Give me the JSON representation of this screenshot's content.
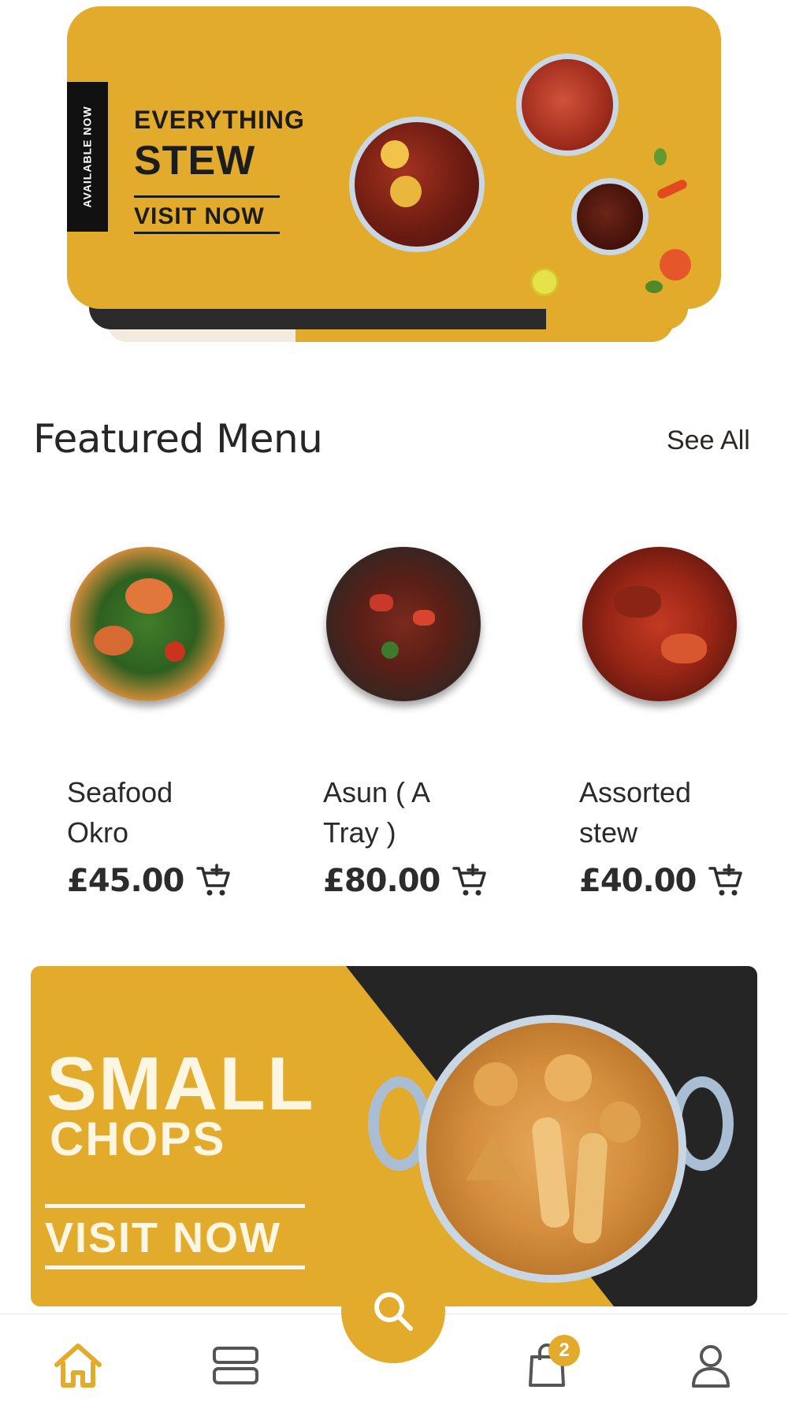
{
  "promo_banner_top": {
    "side_tab": "AVAILABLE NOW",
    "line1": "EVERYTHING",
    "line2": "STEW",
    "cta": "VISIT NOW"
  },
  "featured": {
    "title": "Featured Menu",
    "see_all": "See All",
    "items": [
      {
        "name": "Seafood Okro",
        "price": "£45.00",
        "image": "seafood-okro-dish"
      },
      {
        "name": "Asun ( A Tray )",
        "price": "£80.00",
        "image": "asun-dish"
      },
      {
        "name": "Assorted stew",
        "price": "£40.00",
        "image": "assorted-stew-dish"
      }
    ]
  },
  "promo_banner_bottom": {
    "line1": "SMALL",
    "line2": "CHOPS",
    "cta": "VISIT NOW"
  },
  "bottom_nav": {
    "items": [
      "home-icon",
      "menu-list-icon",
      "search-icon",
      "bag-icon",
      "profile-icon"
    ],
    "active": "home-icon",
    "cart_badge": "2"
  },
  "colors": {
    "accent": "#e2ab2b",
    "dark": "#252525",
    "text": "#262626"
  }
}
